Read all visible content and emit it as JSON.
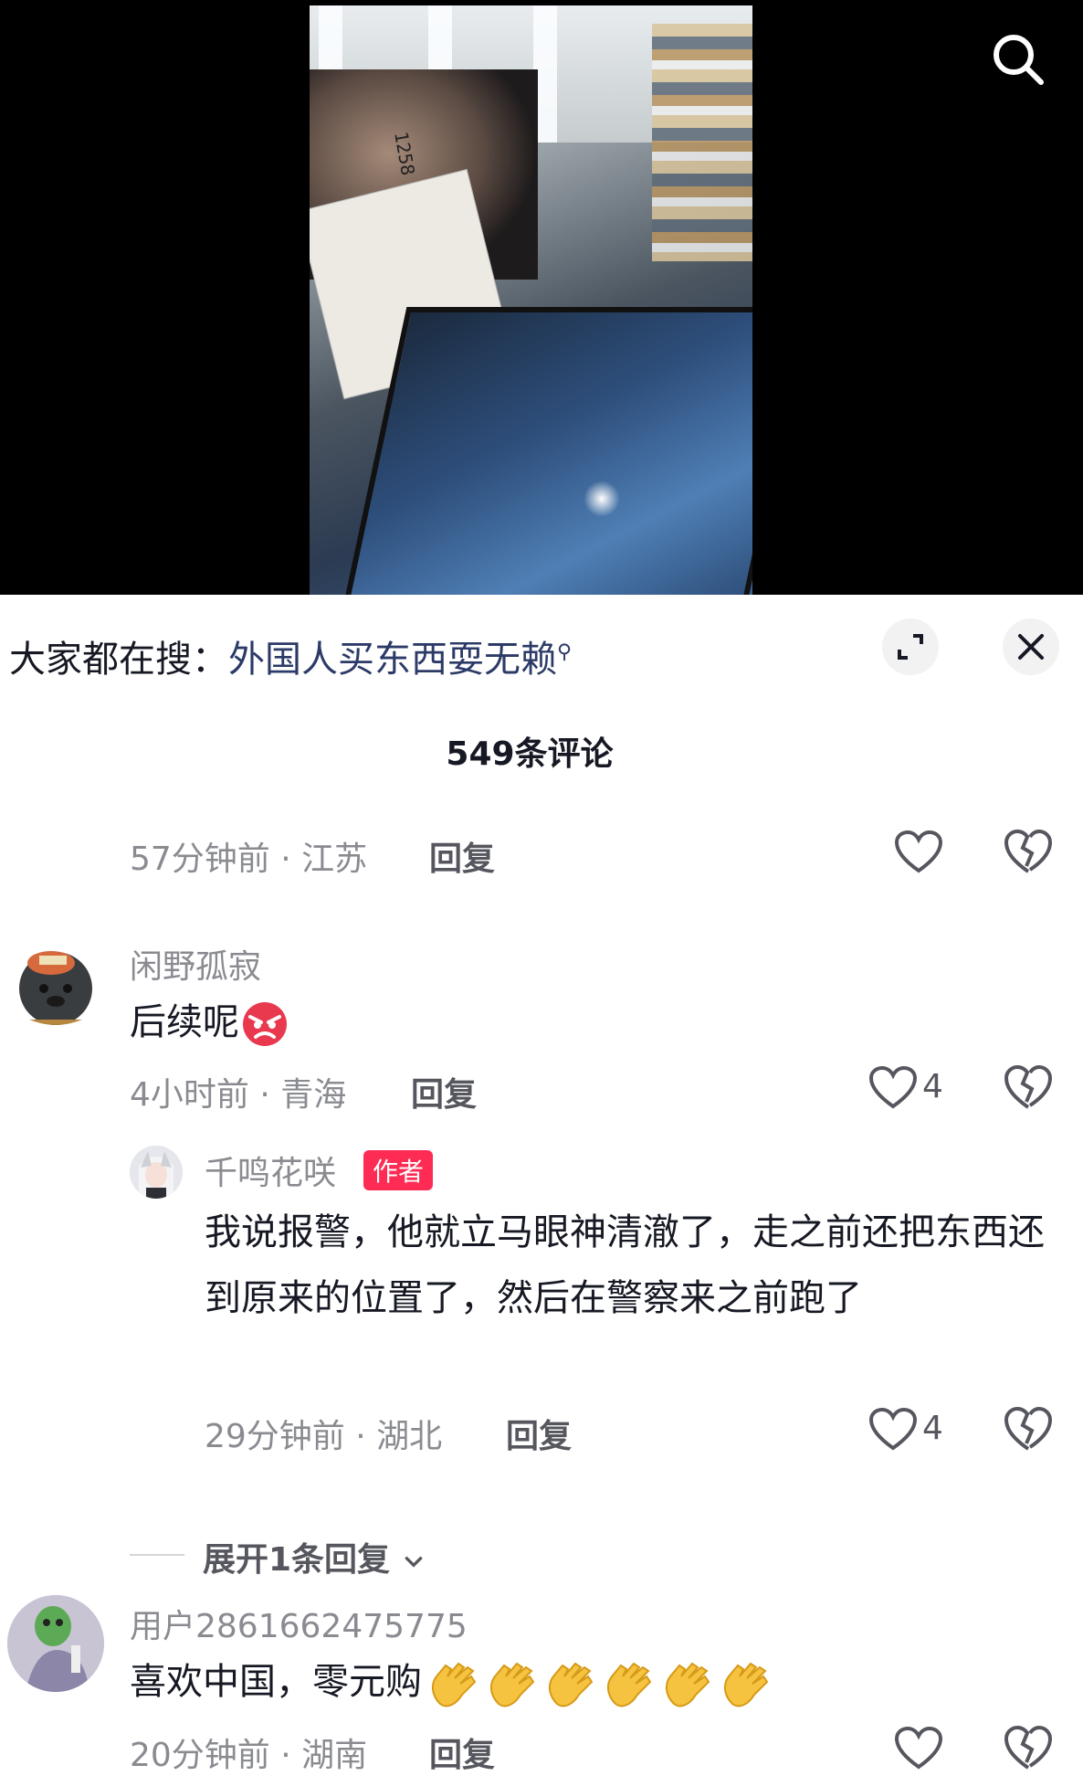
{
  "video": {
    "caption_number": "1258"
  },
  "search": {
    "icon": "search-icon"
  },
  "panel": {
    "hot_search_prefix": "大家都在搜：",
    "hot_search_query": "外国人买东西耍无赖",
    "comment_count": "549条评论"
  },
  "comments": [
    {
      "meta": "57分钟前 · 江苏",
      "reply": "回复"
    },
    {
      "username": "闲野孤寂",
      "text": "后续呢",
      "meta": "4小时前 · 青海",
      "reply": "回复",
      "likes": "4"
    },
    {
      "username": "千鸣花咲",
      "badge": "作者",
      "text": "我说报警，他就立马眼神清澈了，走之前还把东西还到原来的位置了，然后在警察来之前跑了",
      "meta": "29分钟前 · 湖北",
      "reply": "回复",
      "likes": "4"
    },
    {
      "username": "用户2861662475775",
      "text": "喜欢中国，零元购",
      "meta": "20分钟前 · 湖南",
      "reply": "回复"
    }
  ],
  "expand_replies": "展开1条回复"
}
